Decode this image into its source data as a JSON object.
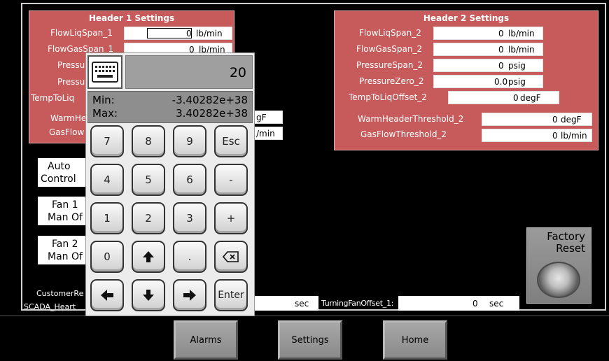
{
  "header1": {
    "title": "Header 1 Settings",
    "rows": [
      {
        "label": "FlowLiqSpan_1",
        "value": "0",
        "unit": "lb/min"
      },
      {
        "label": "FlowGasSpan_1",
        "value": "0",
        "unit": "lb/min"
      },
      {
        "label": "Pressure",
        "value": "",
        "unit": ""
      },
      {
        "label": "Pressure",
        "value": "",
        "unit": ""
      },
      {
        "label": "TempToLiq",
        "value": "",
        "unit": ""
      },
      {
        "label": "WarmHe",
        "value": "",
        "unit": "gF"
      },
      {
        "label": "GasFlow",
        "value": "",
        "unit": "/min"
      }
    ]
  },
  "header2": {
    "title": "Header 2 Settings",
    "rows": [
      {
        "label": "FlowLiqSpan_2",
        "value": "0",
        "unit": "lb/min"
      },
      {
        "label": "FlowGasSpan_2",
        "value": "0",
        "unit": "lb/min"
      },
      {
        "label": "PressureSpan_2",
        "value": "0",
        "unit": "psig"
      },
      {
        "label": "PressureZero_2",
        "value": "0.0",
        "unit": "psig"
      },
      {
        "label": "TempToLiqOffset_2",
        "value": "0",
        "unit": "degF"
      },
      {
        "label": "WarmHeaderThreshold_2",
        "value": "0",
        "unit": "degF"
      },
      {
        "label": "GasFlowThreshold_2",
        "value": "0",
        "unit": "lb/min"
      }
    ]
  },
  "controls": {
    "auto": [
      "Auto",
      "Control"
    ],
    "fan1": [
      "Fan 1",
      "Man Of"
    ],
    "fan2": [
      "Fan 2",
      "Man Of"
    ]
  },
  "bottom": {
    "customer_label": "CustomerRe",
    "scada_label": "SCADA_Heart",
    "left_unit": "sec",
    "turning_label": "TurningFanOffset_1:",
    "turning_value": "0",
    "turning_unit": "sec"
  },
  "factory_reset": [
    "Factory",
    "Reset"
  ],
  "nav": {
    "alarms": "Alarms",
    "settings": "Settings",
    "home": "Home"
  },
  "keypad": {
    "display": "20",
    "min_label": "Min:",
    "min_value": "-3.40282e+38",
    "max_label": "Max:",
    "max_value": "3.40282e+38",
    "keys": [
      "7",
      "8",
      "9",
      "Esc",
      "4",
      "5",
      "6",
      "-",
      "1",
      "2",
      "3",
      "+",
      "0",
      "up-arrow",
      ".",
      "backspace",
      "left-arrow",
      "down-arrow",
      "right-arrow",
      "Enter"
    ]
  },
  "colors": {
    "panel": "#c75a5a",
    "background": "#000000"
  }
}
